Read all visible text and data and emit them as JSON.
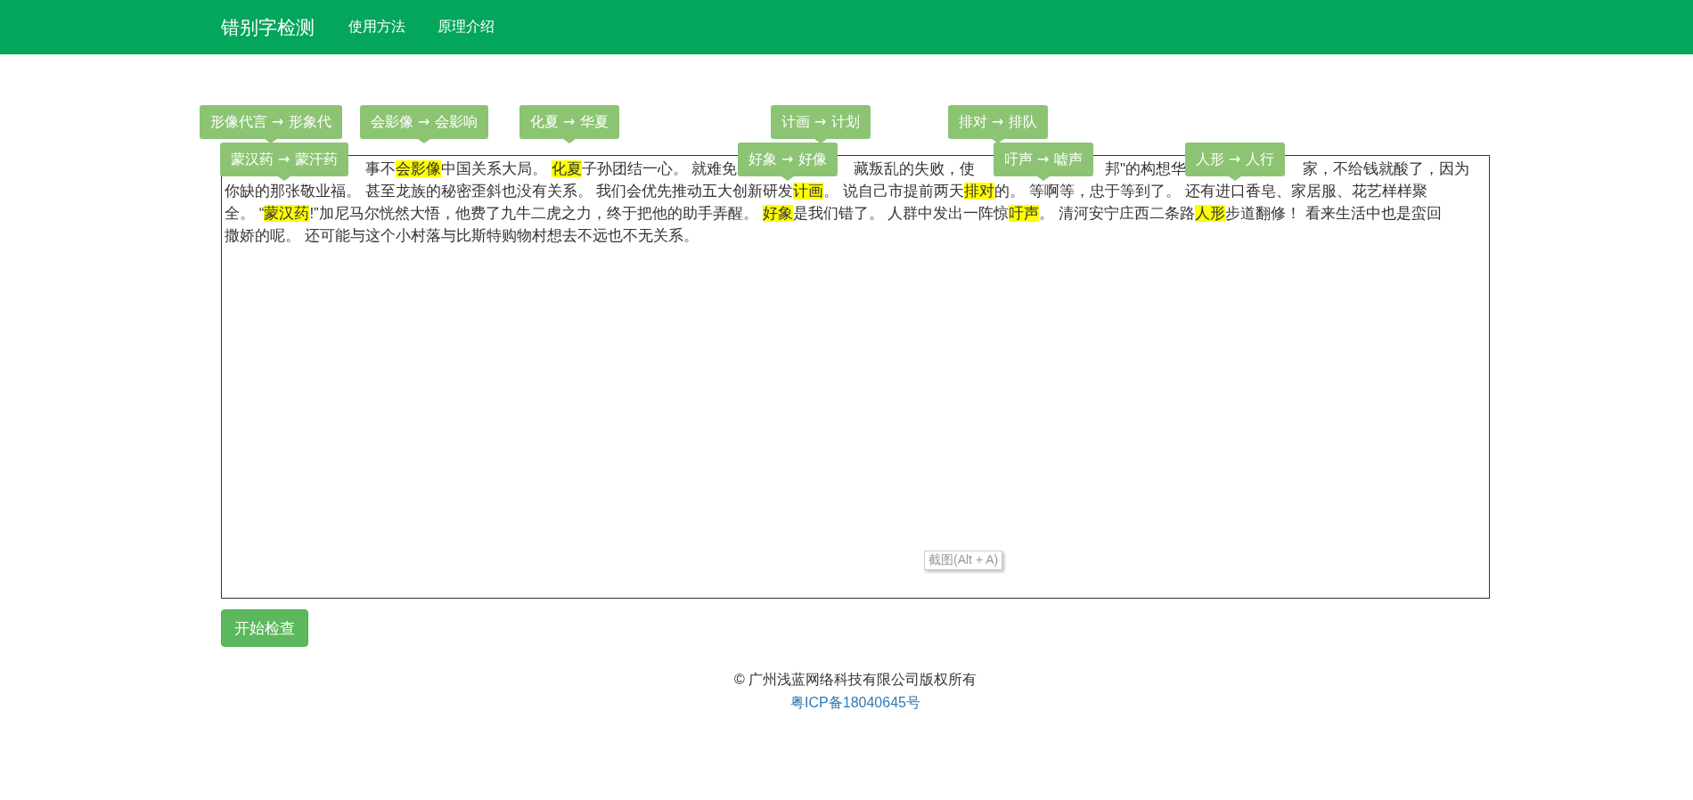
{
  "navbar": {
    "brand": "错别字检测",
    "links": [
      "使用方法",
      "原理介绍"
    ]
  },
  "corrections": [
    {
      "text": "形像代言 → 形象代"
    },
    {
      "text": "会影像 → 会影响"
    },
    {
      "text": "化夏 → 华夏"
    },
    {
      "text": "计画 → 计划"
    },
    {
      "text": "排对 → 排队"
    },
    {
      "text": "蒙汉药 → 蒙汗药"
    },
    {
      "text": "好象 → 好像"
    },
    {
      "text": "吁声 → 嘘声"
    },
    {
      "text": "人形 → 人行"
    }
  ],
  "editor": {
    "lines": [
      {
        "fragments": [
          {
            "segments": [
              {
                "text": "事不",
                "error": false
              },
              {
                "text": "会影像",
                "error": true
              },
              {
                "text": "中国关系大局。 ",
                "error": false
              },
              {
                "text": "化夏",
                "error": true
              },
              {
                "text": "子孙团结一心。 就难免",
                "error": false
              }
            ]
          },
          {
            "segments": [
              {
                "text": "藏叛乱的失败，使",
                "error": false
              }
            ]
          },
          {
            "segments": [
              {
                "text": "邦\"的构想华",
                "error": false
              }
            ]
          },
          {
            "segments": [
              {
                "text": "家，不给钱就酸了，因为",
                "error": false
              }
            ]
          }
        ]
      },
      {
        "fragments": [
          {
            "segments": [
              {
                "text": "你缺的那张敬业福。 甚至龙族的秘密歪斜也没有关系。 我们会优先推动五大创新研发",
                "error": false
              },
              {
                "text": "计画",
                "error": true
              },
              {
                "text": "。 说自己市提前两天",
                "error": false
              },
              {
                "text": "排对",
                "error": true
              },
              {
                "text": "的。 等啊等，忠于等到了。 还有进口香皂、家居服、花艺样样聚",
                "error": false
              }
            ]
          }
        ]
      },
      {
        "fragments": [
          {
            "segments": [
              {
                "text": "全。 “",
                "error": false
              },
              {
                "text": "蒙汉药",
                "error": true
              },
              {
                "text": "!”加尼马尔恍然大悟，他费了九牛二虎之力，终于把他的助手弄醒。 ",
                "error": false
              },
              {
                "text": "好象",
                "error": true
              },
              {
                "text": "是我们错了。 人群中发出一阵惊",
                "error": false
              },
              {
                "text": "吁声",
                "error": true
              },
              {
                "text": "。 清河安宁庄西二条路",
                "error": false
              },
              {
                "text": "人形",
                "error": true
              },
              {
                "text": "步道翻修！ 看来生活中也是蛮回",
                "error": false
              }
            ]
          }
        ]
      },
      {
        "fragments": [
          {
            "segments": [
              {
                "text": "撒娇的呢。 还可能与这个小村落与比斯特购物村想去不远也不无关系。",
                "error": false
              }
            ]
          }
        ]
      }
    ]
  },
  "screenshot_hint": "截图(Alt + A)",
  "check_button": "开始检查",
  "footer": {
    "copyright": "© 广州浅蓝网络科技有限公司版权所有",
    "icp_link": "粤ICP备18040645号"
  }
}
